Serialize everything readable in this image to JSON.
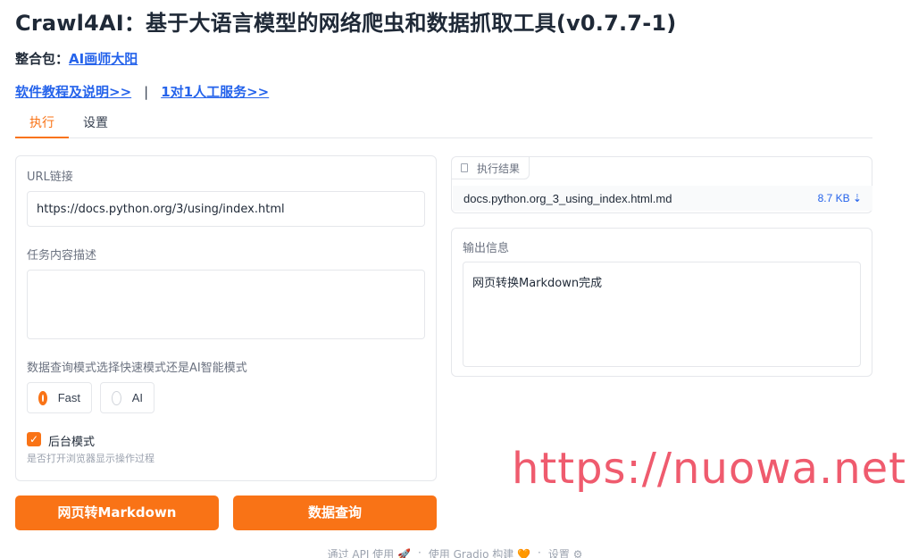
{
  "app": {
    "title": "Crawl4AI：基于大语言模型的网络爬虫和数据抓取工具(v0.7.7-1)",
    "package_label": "整合包：",
    "package_link": "AI画师大阳",
    "link_tutorial": "软件教程及说明>>",
    "link_separator": "|",
    "link_service": "1对1人工服务>>"
  },
  "tabs": [
    {
      "label": "执行",
      "active": true
    },
    {
      "label": "设置",
      "active": false
    }
  ],
  "form": {
    "url_label": "URL链接",
    "url_value": "https://docs.python.org/3/using/index.html",
    "task_label": "任务内容描述",
    "task_value": "",
    "mode_label": "数据查询模式选择快速模式还是AI智能模式",
    "mode_options": [
      {
        "label": "Fast",
        "selected": true
      },
      {
        "label": "AI",
        "selected": false
      }
    ],
    "background_label": "后台模式",
    "background_checked": true,
    "background_hint": "是否打开浏览器显示操作过程"
  },
  "buttons": {
    "to_markdown": "网页转Markdown",
    "query": "数据查询"
  },
  "result": {
    "badge": "执行结果",
    "file_name": "docs.python.org_3_using_index.html.md",
    "file_size": "8.7 KB ⇣"
  },
  "output": {
    "label": "输出信息",
    "text": "网页转换Markdown完成"
  },
  "watermark": "https://nuowa.net",
  "footer": {
    "api": "通过 API 使用 🚀",
    "gradio": "使用 Gradio 构建 🧡",
    "settings": "设置 ⚙",
    "dot": "·"
  },
  "colors": {
    "accent": "#f97316",
    "link": "#2563eb",
    "watermark": "#ef5b6e"
  }
}
